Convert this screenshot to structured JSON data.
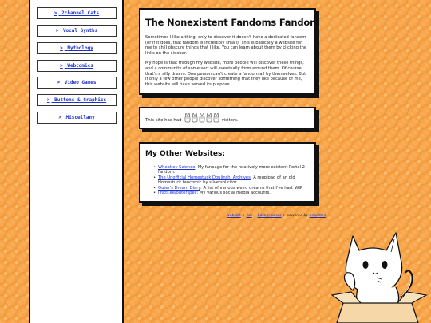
{
  "sidebar": {
    "items": [
      {
        "label": "2channel Cats"
      },
      {
        "label": "Vocal Synths"
      },
      {
        "label": "Mythology"
      },
      {
        "label": "Webcomics"
      },
      {
        "label": "Video Games"
      },
      {
        "label": "Buttons & Graphics"
      },
      {
        "label": "Miscellany"
      }
    ],
    "arrow": ">"
  },
  "main": {
    "title": "The Nonexistent Fandoms Fandom",
    "para1": "Sometimes I like a thing, only to discover it doesn't have a dedicated fandom (or if it does, that fandom is incredibly small). This is basically a website for me to shill obscure things that I like. You can learn about them by clicking the links on the sidebar.",
    "para2": "My hope is that through my website, more people will discover these things, and a community of some sort will eventually form around them. Of course, that's a silly dream. One person can't create a fandom all by themselves. But if only a few other people discover something that they like because of me, this website will have served its purpose."
  },
  "counter": {
    "prefix": "This site has had",
    "suffix": "visitors."
  },
  "other_sites": {
    "title": "My Other Websites:",
    "items": [
      {
        "link": "Wheatley Science",
        "desc": ": My fanpage for the relatively more existent Portal 2 fandom."
      },
      {
        "link": "The Unofficial Homestuck Doujinshi Archives",
        "desc": ": A reupload of an old Homestuck fancomic by silversolicitor."
      },
      {
        "link": "Outer's Dream Diary",
        "desc": ": A list of various weird dreams that I've had. WIP"
      },
      {
        "link": "linktr.ee/outerspec",
        "desc": ": My various social media accounts."
      }
    ]
  },
  "footer": {
    "website": "website",
    "sep": " + ",
    "css": "css",
    "backgrounds": "backgrounds",
    "powered_by": " + powered by ",
    "neocities": "neocities"
  },
  "colors": {
    "background": "#f39a3c",
    "link": "#1c2fd0"
  }
}
